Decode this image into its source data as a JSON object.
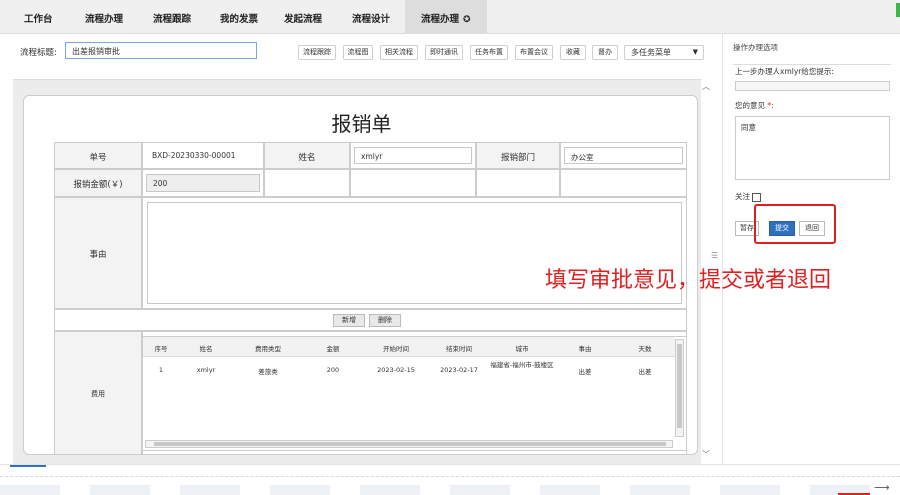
{
  "nav": {
    "tabs": [
      {
        "label": "工作台"
      },
      {
        "label": "流程办理"
      },
      {
        "label": "流程跟踪"
      },
      {
        "label": "我的发票"
      },
      {
        "label": "发起流程"
      },
      {
        "label": "流程设计"
      },
      {
        "label": "流程办理",
        "active": true
      }
    ],
    "gear_icon": "gear-icon"
  },
  "title_row": {
    "label": "流程标题:",
    "value": "出差报销审批"
  },
  "toolbar": {
    "buttons": [
      "流程跟踪",
      "流程图",
      "相关流程",
      "即时通讯",
      "任务布置",
      "布置会议",
      "收藏",
      "督办"
    ],
    "multi_task_menu": "多任务菜单"
  },
  "form": {
    "title": "报销单",
    "order_no_label": "单号",
    "order_no": "BXD-20230330-00001",
    "name_label": "姓名",
    "name": "xmlyr",
    "dept_label": "报销部门",
    "dept": "办公室",
    "amount_label": "报销金额(￥)",
    "amount": "200",
    "reason_label": "事由",
    "add_btn": "新增",
    "delete_btn": "删除",
    "expense_label": "费用",
    "grid": {
      "columns": [
        "序号",
        "姓名",
        "费用类型",
        "金额",
        "开始时间",
        "结束时间",
        "城市",
        "事由",
        "天数"
      ],
      "rows": [
        [
          "1",
          "xmlyr",
          "差旅类",
          "200",
          "2023-02-15",
          "2023-02-17",
          "福建省-福州市-鼓楼区",
          "出差",
          "出差"
        ]
      ]
    }
  },
  "panel": {
    "title": "操作办理选项",
    "prev_hint": "上一步办理人xmlyr给您提示:",
    "opinion_label": "您的意见",
    "opinion_required": "*:",
    "opinion": "同意",
    "follow_label": "关注",
    "buttons": {
      "save": "暂存",
      "submit": "提交",
      "back": "退回"
    }
  },
  "annotation": "填写审批意见，提交或者退回",
  "colors": {
    "accent": "#3070c0",
    "annotation": "#e02020",
    "green": "#3cb54a"
  }
}
